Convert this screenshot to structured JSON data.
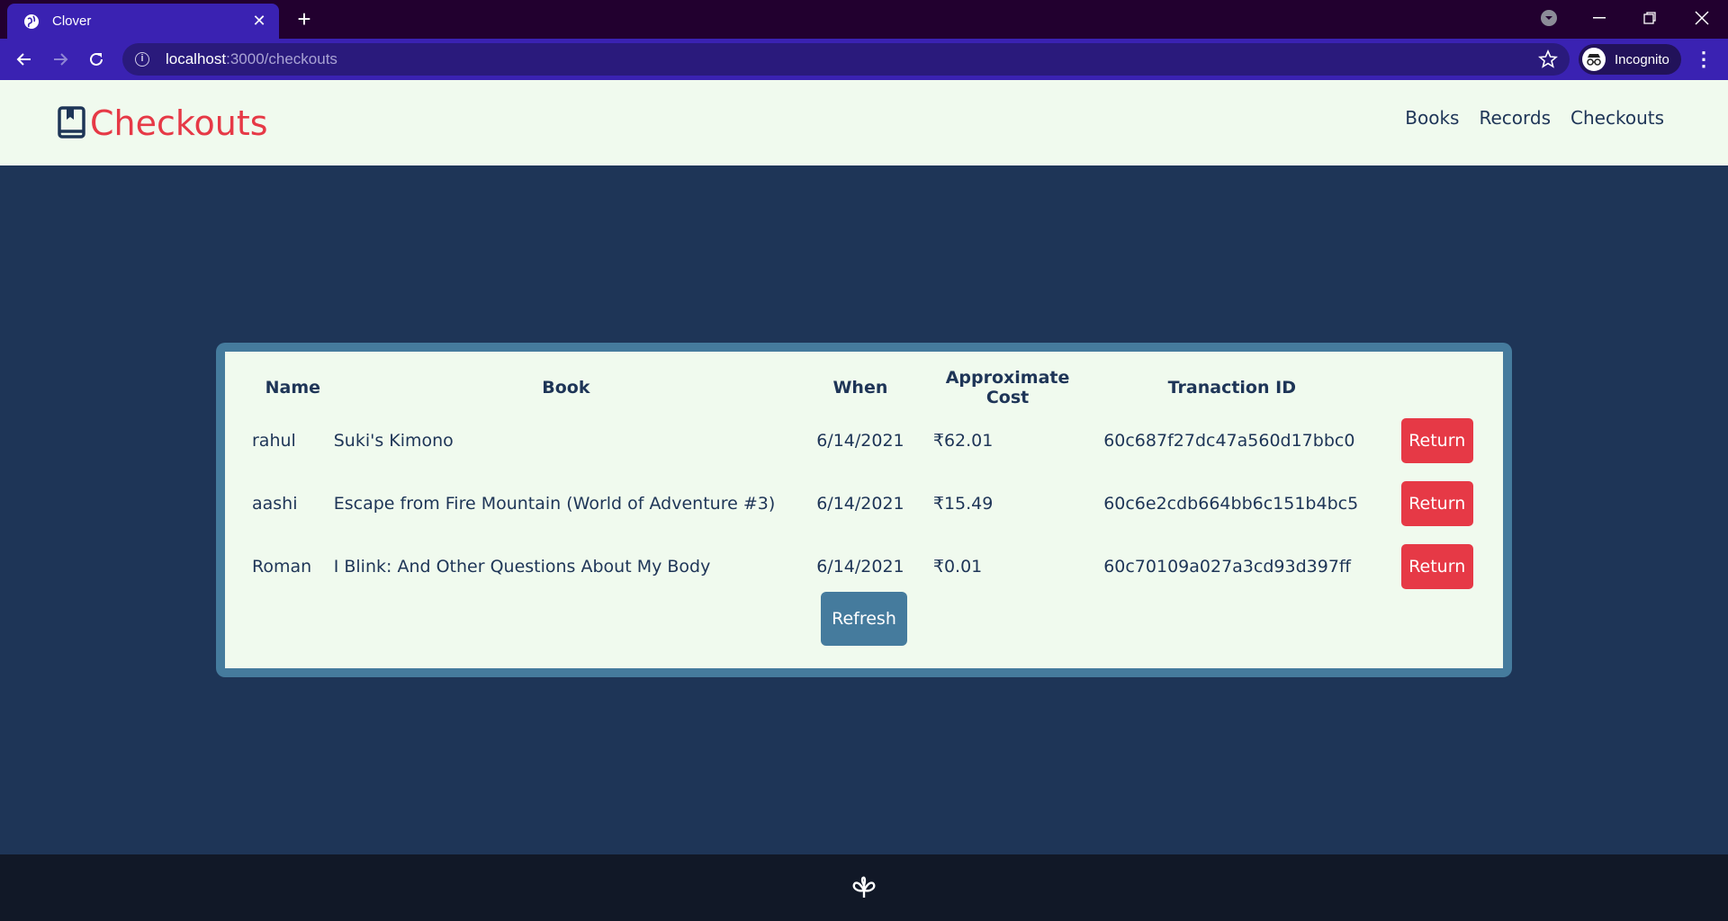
{
  "browser": {
    "tab_title": "Clover",
    "url_host": "localhost",
    "url_path": ":3000/checkouts",
    "incognito_label": "Incognito"
  },
  "header": {
    "title": "Checkouts",
    "nav": [
      "Books",
      "Records",
      "Checkouts"
    ]
  },
  "table": {
    "columns": [
      "Name",
      "Book",
      "When",
      "Approximate Cost",
      "Tranaction ID"
    ],
    "rows": [
      {
        "name": "rahul",
        "book": "Suki's Kimono",
        "when": "6/14/2021",
        "cost": "₹62.01",
        "tid": "60c687f27dc47a560d17bbc0",
        "action": "Return"
      },
      {
        "name": "aashi",
        "book": "Escape from Fire Mountain (World of Adventure #3)",
        "when": "6/14/2021",
        "cost": "₹15.49",
        "tid": "60c6e2cdb664bb6c151b4bc5",
        "action": "Return"
      },
      {
        "name": "Roman",
        "book": "I Blink: And Other Questions About My Body",
        "when": "6/14/2021",
        "cost": "₹0.01",
        "tid": "60c70109a027a3cd93d397ff",
        "action": "Return"
      }
    ],
    "refresh_label": "Refresh"
  },
  "colors": {
    "accent": "#e63946",
    "primary": "#1e3557",
    "secondary": "#457b9d",
    "light": "#f0faee"
  }
}
